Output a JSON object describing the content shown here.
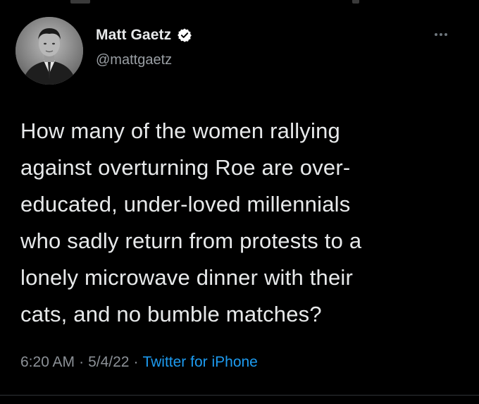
{
  "tweet": {
    "author": {
      "display_name": "Matt Gaetz",
      "handle": "@mattgaetz",
      "verified": true,
      "avatar": "profile-photo"
    },
    "text_lines": [
      "How many of the women rallying",
      "against overturning Roe are over-",
      "educated, under-loved millennials",
      "who sadly return from protests to a",
      "lonely microwave dinner with their",
      "cats, and no bumble matches?"
    ],
    "time": "6:20 AM",
    "separator": "·",
    "date": "5/4/22",
    "source": "Twitter for iPhone"
  },
  "icons": {
    "verified": "verified-badge-icon",
    "more": "more-options-icon"
  },
  "colors": {
    "background": "#000000",
    "primary_text": "#e7e9ea",
    "secondary_text": "#8b9096",
    "link": "#1d9bf0",
    "verified_badge": "#ffffff"
  }
}
